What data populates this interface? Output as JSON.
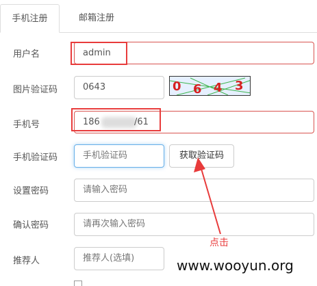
{
  "tabs": [
    {
      "label": "手机注册",
      "active": true
    },
    {
      "label": "邮箱注册",
      "active": false
    }
  ],
  "form": {
    "username": {
      "label": "用户名",
      "value": "admin"
    },
    "captcha": {
      "label": "图片验证码",
      "value": "0643",
      "image_digits": [
        "0",
        "6",
        "4",
        "3"
      ]
    },
    "phone": {
      "label": "手机号",
      "value_left": "186",
      "value_right": "/61"
    },
    "sms_code": {
      "label": "手机验证码",
      "placeholder": "手机验证码",
      "button": "获取验证码"
    },
    "password": {
      "label": "设置密码",
      "placeholder": "请输入密码"
    },
    "confirm": {
      "label": "确认密码",
      "placeholder": "请再次输入密码"
    },
    "referrer": {
      "label": "推荐人",
      "placeholder": "推荐人(选填)"
    }
  },
  "annotation": {
    "click_label": "点击",
    "color": "#e83b3b"
  },
  "watermark": "www.wooyun.org",
  "colors": {
    "accent_red": "#e83b3b",
    "focus_blue": "#66afe9",
    "border": "#cccccc"
  }
}
